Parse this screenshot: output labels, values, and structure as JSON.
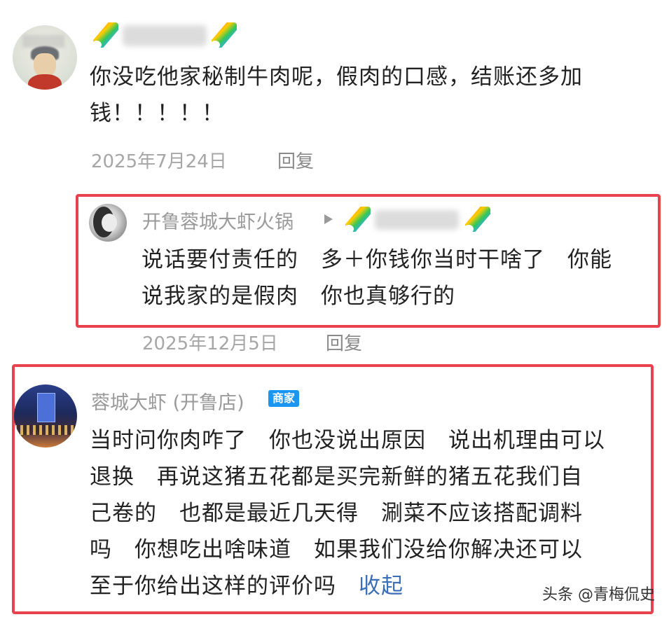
{
  "comments": [
    {
      "author": "",
      "text_lines": [
        "你没吃他家秘制牛肉呢，假肉的口感，结账还多加",
        "钱！！！！！"
      ],
      "date": "2025年7月24日",
      "reply_label": "回复"
    },
    {
      "author": "开鲁蓉城大虾火锅",
      "text_lines": [
        "说话要付责任的　多＋你钱你当时干啥了　你能",
        "说我家的是假肉　你也真够行的"
      ],
      "date": "2025年12月5日",
      "reply_label": "回复"
    },
    {
      "author": "蓉城大虾 (开鲁店)",
      "badge": "商家",
      "text_lines": [
        "当时问你肉咋了　你也没说出原因　说出机理由可以",
        "退换　再说这猪五花都是买完新鲜的猪五花我们自",
        "己卷的　也都是最近几天得　涮菜不应该搭配调料",
        "吗　你想吃出啥味道　如果我们没给你解决还可以",
        "至于你给出这样的评价吗"
      ],
      "collapse_label": "收起"
    }
  ],
  "watermark": "头条 @青梅侃史",
  "colors": {
    "highlight_border": "#e8424e",
    "merchant_badge": "#1a96f0",
    "link": "#3a6fb7"
  },
  "icons": [
    "rainbow-emoji-icon",
    "play-arrow-icon"
  ]
}
